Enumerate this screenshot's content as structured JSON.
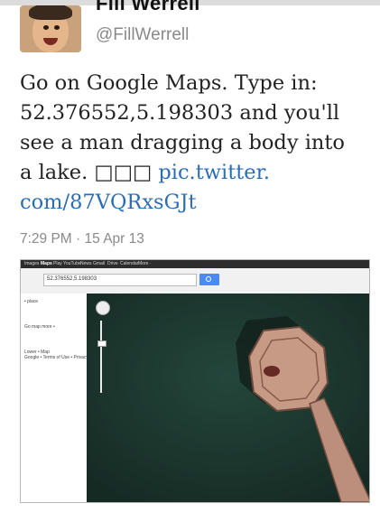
{
  "tweet": {
    "name": "Fill Werrell",
    "handle": "@FillWerrell",
    "text_lines": [
      "Go on Google Maps. Type in:",
      "52.376552,5.198303 and you'll",
      "see a man dragging a body into",
      "a lake. □□□ "
    ],
    "link_part1": "pic.twitter.",
    "link_part2": "com/87VQRxsGJt",
    "timestamp": "7:29 PM · 15 Apr 13"
  },
  "maps_screenshot": {
    "nav_items": [
      "Images",
      "Maps",
      "Play",
      "YouTube",
      "News",
      "Gmail",
      "Drive",
      "Calendar",
      "More ·"
    ],
    "search_value": "52.376552,5.198303",
    "sidebar_items": [
      "• place",
      "Go map   more •",
      "Lower • Map",
      "Google • Terms of Use • Privacy"
    ]
  },
  "colors": {
    "link": "#2a6db5",
    "water": "#1f3a32",
    "pier": "#c79a86"
  },
  "icons": [
    "avatar-photo",
    "search-icon",
    "zoom-control-icon",
    "pegman-icon"
  ]
}
